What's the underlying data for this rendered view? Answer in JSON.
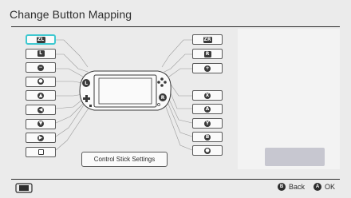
{
  "header": {
    "title": "Change Button Mapping"
  },
  "left_buttons": [
    {
      "name": "zl-button",
      "glyph": "ZL",
      "shape": "wide",
      "selected": true
    },
    {
      "name": "l-button",
      "glyph": "L",
      "shape": "box"
    },
    {
      "name": "minus-button",
      "glyph": "−",
      "shape": "round"
    },
    {
      "name": "left-stick-button",
      "glyph": "●",
      "shape": "round"
    },
    {
      "name": "up-button",
      "glyph": "▲",
      "shape": "round"
    },
    {
      "name": "left-dpad-button",
      "glyph": "◀",
      "shape": "round"
    },
    {
      "name": "down-button",
      "glyph": "▼",
      "shape": "round"
    },
    {
      "name": "right-dpad-button",
      "glyph": "▶",
      "shape": "round"
    },
    {
      "name": "capture-button",
      "glyph": "",
      "shape": "sq"
    }
  ],
  "right_buttons": [
    {
      "name": "zr-button",
      "glyph": "ZR",
      "shape": "wide"
    },
    {
      "name": "r-button",
      "glyph": "R",
      "shape": "box"
    },
    {
      "name": "plus-button",
      "glyph": "+",
      "shape": "round"
    },
    {
      "name": "x-button",
      "glyph": "X",
      "shape": "round"
    },
    {
      "name": "a-button",
      "glyph": "A",
      "shape": "round"
    },
    {
      "name": "y-button",
      "glyph": "Y",
      "shape": "round"
    },
    {
      "name": "b-button",
      "glyph": "B",
      "shape": "round"
    },
    {
      "name": "right-stick-button",
      "glyph": "●",
      "shape": "round"
    }
  ],
  "controls": {
    "stick_settings_label": "Control Stick Settings",
    "disabled_button_label": ""
  },
  "footer": {
    "back_glyph": "B",
    "back_label": "Back",
    "ok_glyph": "A",
    "ok_label": "OK"
  },
  "colors": {
    "background": "#ebebeb",
    "selection": "#3ec8d0",
    "text": "#2d2d2d",
    "disabled_button": "#c7c7d0"
  }
}
